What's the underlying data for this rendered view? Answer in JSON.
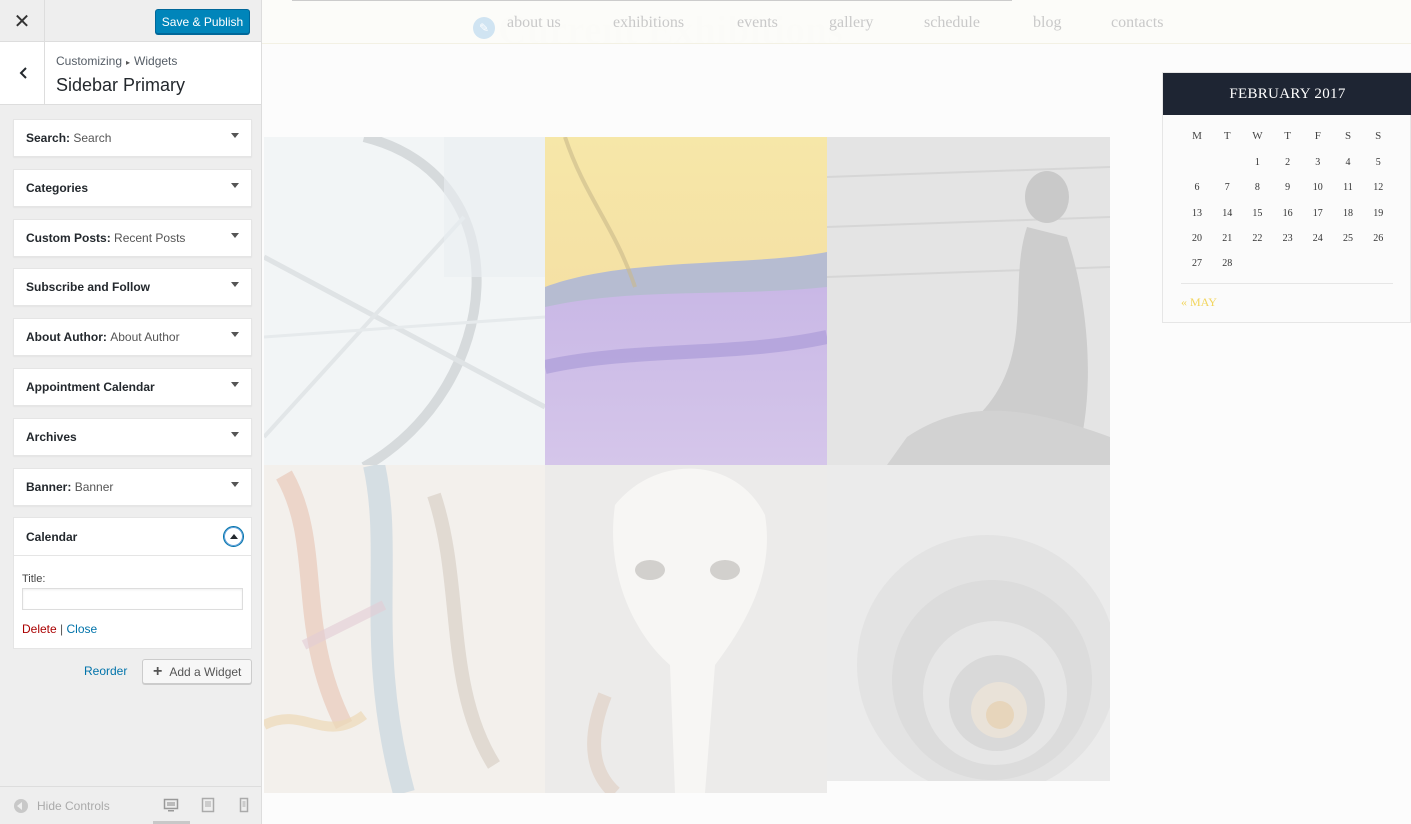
{
  "header": {
    "close_icon": "close-icon",
    "save_label": "Save & Publish"
  },
  "section": {
    "breadcrumb_root": "Customizing",
    "breadcrumb_current": "Widgets",
    "title": "Sidebar Primary"
  },
  "widgets": [
    {
      "name": "Search",
      "sub": "Search"
    },
    {
      "name": "Categories",
      "sub": ""
    },
    {
      "name": "Custom Posts",
      "sub": "Recent Posts"
    },
    {
      "name": "Subscribe and Follow",
      "sub": ""
    },
    {
      "name": "About Author",
      "sub": "About Author"
    },
    {
      "name": "Appointment Calendar",
      "sub": ""
    },
    {
      "name": "Archives",
      "sub": ""
    },
    {
      "name": "Banner",
      "sub": "Banner"
    }
  ],
  "calendar_widget": {
    "name": "Calendar",
    "title_label": "Title:",
    "title_value": "",
    "delete_label": "Delete",
    "separator": "|",
    "close_label": "Close"
  },
  "actions": {
    "reorder_label": "Reorder",
    "add_widget_label": "Add a Widget"
  },
  "footer": {
    "hide_controls_label": "Hide Controls"
  },
  "preview": {
    "nav": [
      "about us",
      "exhibitions",
      "events",
      "gallery",
      "schedule",
      "blog",
      "contacts"
    ],
    "heading": "Current Exhibitions",
    "calendar": {
      "month": "FEBRUARY 2017",
      "weekdays": [
        "M",
        "T",
        "W",
        "T",
        "F",
        "S",
        "S"
      ],
      "weeks": [
        [
          "",
          "",
          "1",
          "2",
          "3",
          "4",
          "5"
        ],
        [
          "6",
          "7",
          "8",
          "9",
          "10",
          "11",
          "12"
        ],
        [
          "13",
          "14",
          "15",
          "16",
          "17",
          "18",
          "19"
        ],
        [
          "20",
          "21",
          "22",
          "23",
          "24",
          "25",
          "26"
        ],
        [
          "27",
          "28",
          "",
          "",
          "",
          "",
          ""
        ]
      ],
      "prev_link": "« MAY"
    }
  },
  "colors": {
    "primary_button": "#0085ba",
    "link": "#0073aa",
    "delete": "#aa0000",
    "calendar_header": "#1e2533",
    "calendar_prev_link": "#f2d55d"
  }
}
